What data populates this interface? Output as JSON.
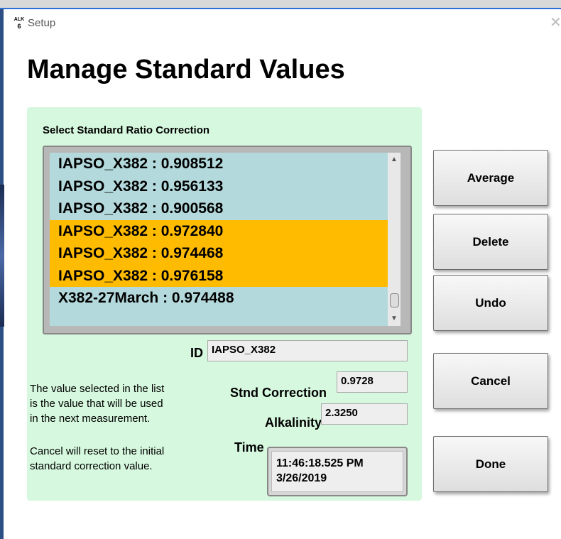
{
  "window": {
    "app_icon_text_top": "ALK",
    "app_icon_text_bottom": "6",
    "title": "Setup",
    "close_glyph": "✕"
  },
  "page": {
    "heading": "Manage Standard Values"
  },
  "list": {
    "label": "Select Standard Ratio Correction",
    "items": [
      {
        "text": "IAPSO_X382 :  0.908512",
        "selected": false
      },
      {
        "text": "IAPSO_X382 :  0.956133",
        "selected": false
      },
      {
        "text": "IAPSO_X382 :  0.900568",
        "selected": false
      },
      {
        "text": "IAPSO_X382 :  0.972840",
        "selected": true
      },
      {
        "text": "IAPSO_X382 :  0.974468",
        "selected": true
      },
      {
        "text": "IAPSO_X382 :  0.976158",
        "selected": true
      },
      {
        "text": "X382-27March :  0.974488",
        "selected": false
      }
    ],
    "scroll_up_glyph": "▲",
    "scroll_down_glyph": "▼",
    "selected_color": "#ffbb00",
    "background_color": "#b3d9dc"
  },
  "fields": {
    "id_label": "ID",
    "id_value": "IAPSO_X382",
    "correction_label": "Stnd Correction",
    "correction_value": "0.9728",
    "alkalinity_label": "Alkalinity",
    "alkalinity_value": "2.3250",
    "time_label": "Time",
    "time_line1": "11:46:18.525 PM",
    "time_line2": "3/26/2019"
  },
  "notes": {
    "line1": "The value selected in the list",
    "line2": "is the value that will be used",
    "line3": "in the next measurement.",
    "line4": "Cancel will reset to the initial",
    "line5": "standard correction value."
  },
  "buttons": {
    "average": "Average",
    "delete": "Delete",
    "undo": "Undo",
    "cancel": "Cancel",
    "done": "Done"
  },
  "colors": {
    "panel": "#d6f8de",
    "title_bar_accent": "#2e6fd6"
  }
}
